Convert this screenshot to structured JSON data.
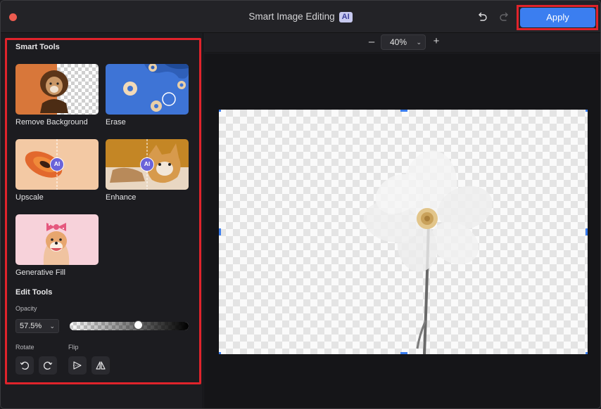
{
  "window": {
    "title": "Smart Image Editing",
    "title_badge": "AI",
    "apply_label": "Apply",
    "icons": {
      "close": "close-dot-icon",
      "undo": "undo-icon",
      "redo": "redo-icon"
    },
    "colors": {
      "accent": "#3b7ef0",
      "highlight": "#e0232b",
      "close_dot": "#ec5b4f"
    }
  },
  "sidebar": {
    "smart_tools_title": "Smart Tools",
    "tools": [
      {
        "label": "Remove Background",
        "icon": "remove-background-thumbnail"
      },
      {
        "label": "Erase",
        "icon": "erase-thumbnail"
      },
      {
        "label": "Upscale",
        "icon": "upscale-thumbnail",
        "badge": "AI"
      },
      {
        "label": "Enhance",
        "icon": "enhance-thumbnail",
        "badge": "AI"
      },
      {
        "label": "Generative Fill",
        "icon": "generative-fill-thumbnail"
      }
    ],
    "edit_tools_title": "Edit Tools",
    "opacity": {
      "label": "Opacity",
      "value": "57.5%",
      "fraction": 0.575
    },
    "rotate_label": "Rotate",
    "flip_label": "Flip",
    "rotate_buttons": [
      "rotate-left-icon",
      "rotate-right-icon"
    ],
    "flip_buttons": [
      "flip-horizontal-icon",
      "flip-vertical-icon"
    ]
  },
  "canvas": {
    "zoom": {
      "minus": "–",
      "value": "40%",
      "plus": "+"
    },
    "image_subject": "white-flower-transparent-background"
  }
}
